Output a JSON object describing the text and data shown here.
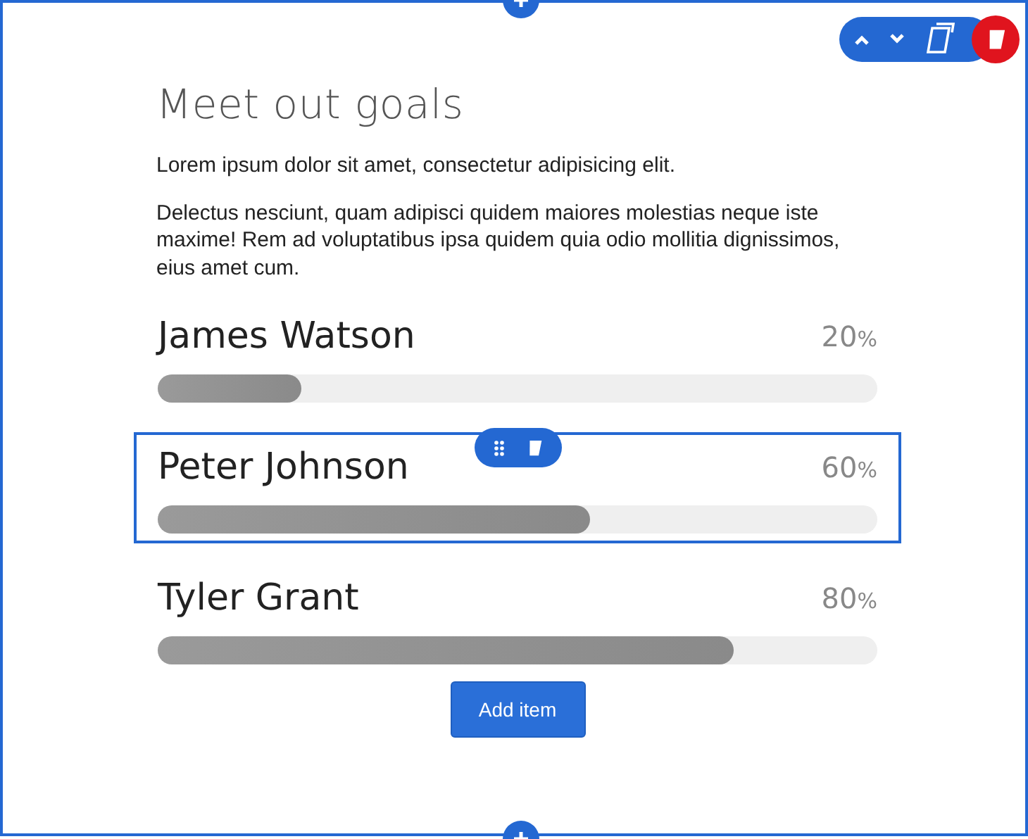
{
  "title": "Meet out goals",
  "paragraphs": [
    "Lorem ipsum dolor sit amet, consectetur adipisicing elit.",
    "Delectus nesciunt, quam adipisci quidem maiores molestias neque iste maxime! Rem ad voluptatibus ipsa quidem quia odio mollitia dignissimos, eius amet cum."
  ],
  "items": [
    {
      "name": "James Watson",
      "value": "20",
      "unit": "%",
      "level": 0.2,
      "selected": false
    },
    {
      "name": "Peter Johnson",
      "value": "60",
      "unit": "%",
      "level": 0.6,
      "selected": true
    },
    {
      "name": "Tyler Grant",
      "value": "80",
      "unit": "%",
      "level": 0.8,
      "selected": false
    }
  ],
  "add_button": "Add item"
}
